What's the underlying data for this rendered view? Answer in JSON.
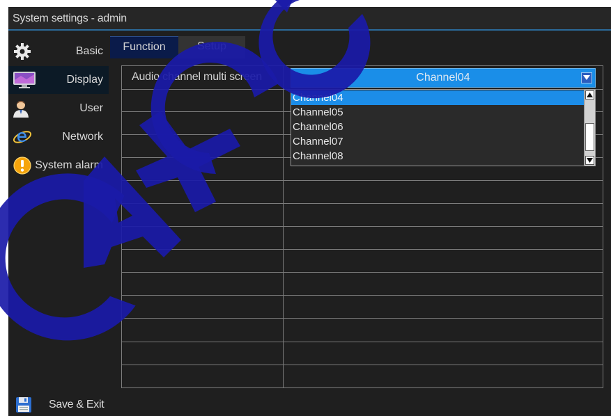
{
  "window": {
    "title": "System settings - admin"
  },
  "sidebar": {
    "items": [
      {
        "label": "Basic",
        "icon": "gear-icon"
      },
      {
        "label": "Display",
        "icon": "monitor-icon"
      },
      {
        "label": "User",
        "icon": "user-icon"
      },
      {
        "label": "Network",
        "icon": "internet-explorer-icon"
      },
      {
        "label": "System alarm",
        "icon": "warning-icon"
      }
    ],
    "active_index": 1
  },
  "tabs": [
    {
      "label": "Function"
    },
    {
      "label": "Setup"
    }
  ],
  "settings": {
    "rows": [
      {
        "label": "Audio channel multi screen",
        "value": "Channel04"
      }
    ]
  },
  "dropdown": {
    "options": [
      "Channel04",
      "Channel05",
      "Channel06",
      "Channel07",
      "Channel08"
    ],
    "selected_index": 0
  },
  "footer": {
    "save_exit_label": "Save & Exit",
    "save_icon": "floppy-disk-icon"
  },
  "watermark": {
    "text": "CAY CC",
    "color": "#1a1aa8"
  },
  "colors": {
    "accent": "#1a8ee8",
    "tab_active": "#0a1b4a",
    "background": "#1f1f1f"
  }
}
